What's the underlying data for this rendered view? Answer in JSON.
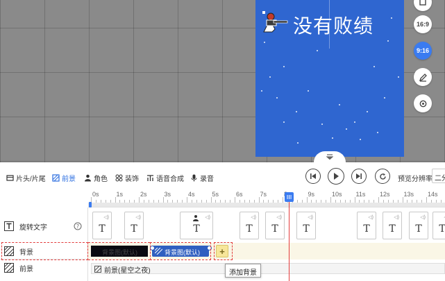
{
  "preview": {
    "overlay_text": "没有败绩",
    "sticker_icon": "soldier-sticker",
    "ratio_buttons": [
      "16:9",
      "9:16"
    ],
    "active_ratio": "9:16",
    "edit_icon": "pencil-icon",
    "settings_icon": "gear-icon",
    "collapse_icon": "chevron-down-icon"
  },
  "toolbar": {
    "tabs": [
      {
        "label": "片头/片尾",
        "icon": "film-icon"
      },
      {
        "label": "前景",
        "icon": "foreground-icon",
        "active": true
      },
      {
        "label": "角色",
        "icon": "person-icon"
      },
      {
        "label": "装饰",
        "icon": "decor-icon"
      },
      {
        "label": "语音合成",
        "icon": "tts-icon"
      },
      {
        "label": "录音",
        "icon": "mic-icon"
      }
    ],
    "player": [
      "skip-back-icon",
      "play-icon",
      "skip-forward-icon",
      "replay-icon"
    ],
    "preview_resolution_label": "预览分辨率",
    "preview_resolution_value": "二分"
  },
  "ruler": {
    "ticks": [
      "0s",
      "1s",
      "2s",
      "3s",
      "4s",
      "5s",
      "6s",
      "7s",
      "8s",
      "9s",
      "10s",
      "11s",
      "12s",
      "13s",
      "14s"
    ]
  },
  "tracks": {
    "rotate_text": {
      "label": "旋转文字",
      "help_icon": "help-icon"
    },
    "background": {
      "label": "背景",
      "clips": [
        "背景图(默认)",
        "背景图(默认)"
      ],
      "add_button": "+"
    },
    "foreground": {
      "label": "前景",
      "clip": "前景(星空之夜)"
    }
  },
  "tooltip": "添加背景",
  "colors": {
    "accent": "#3a7bf0",
    "frame_bg": "#2f66d0",
    "playhead": "#e43b3b",
    "highlight": "#e23a3a"
  }
}
